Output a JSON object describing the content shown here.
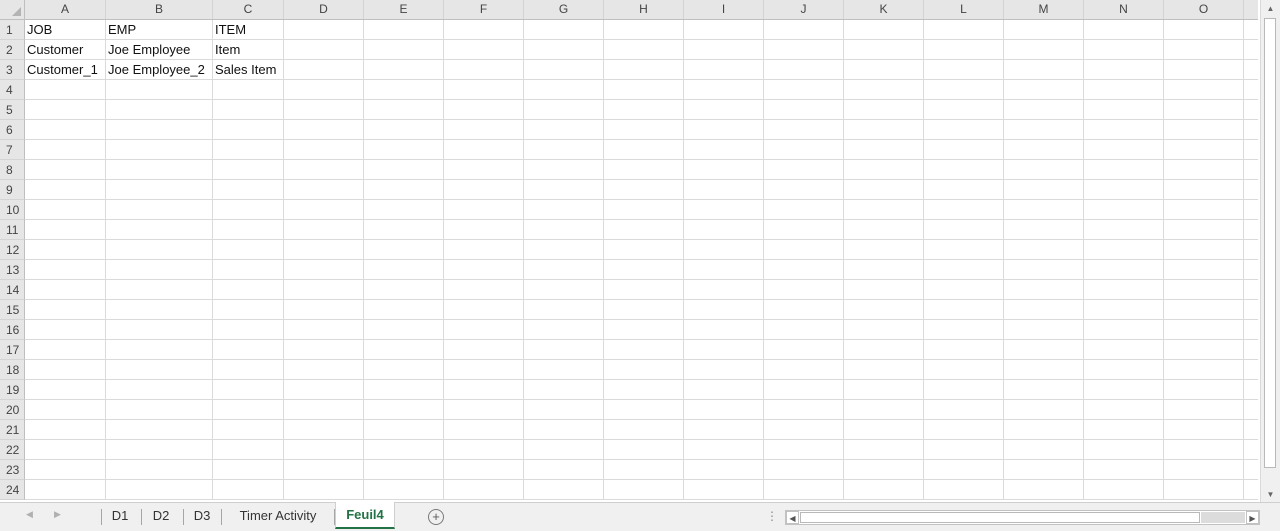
{
  "columns": [
    "A",
    "B",
    "C",
    "D",
    "E",
    "F",
    "G",
    "H",
    "I",
    "J",
    "K",
    "L",
    "M",
    "N",
    "O"
  ],
  "rows": [
    "1",
    "2",
    "3",
    "4",
    "5",
    "6",
    "7",
    "8",
    "9",
    "10",
    "11",
    "12",
    "13",
    "14",
    "15",
    "16",
    "17",
    "18",
    "19",
    "20",
    "21",
    "22",
    "23",
    "24"
  ],
  "cells": [
    [
      "JOB",
      "EMP",
      "ITEM"
    ],
    [
      "Customer",
      "Joe Employee",
      "Item"
    ],
    [
      "Customer_1",
      "Joe Employee_2",
      "Sales Item"
    ]
  ],
  "sheet_tabs": [
    {
      "label": "D1",
      "active": false
    },
    {
      "label": "D2",
      "active": false
    },
    {
      "label": "D3",
      "active": false
    },
    {
      "label": "Timer Activity",
      "active": false
    },
    {
      "label": "Feuil4",
      "active": true
    }
  ],
  "icons": {
    "scroll_left": "◀",
    "scroll_right": "▶",
    "add_sheet": "+",
    "vscroll_up": "▲",
    "vscroll_down": "▼",
    "hscroll_left": "◀",
    "hscroll_right": "▶",
    "more": "⋮"
  },
  "colors": {
    "active_tab": "#217346",
    "header_bg": "#e6e6e6",
    "grid_line": "#dadada"
  }
}
